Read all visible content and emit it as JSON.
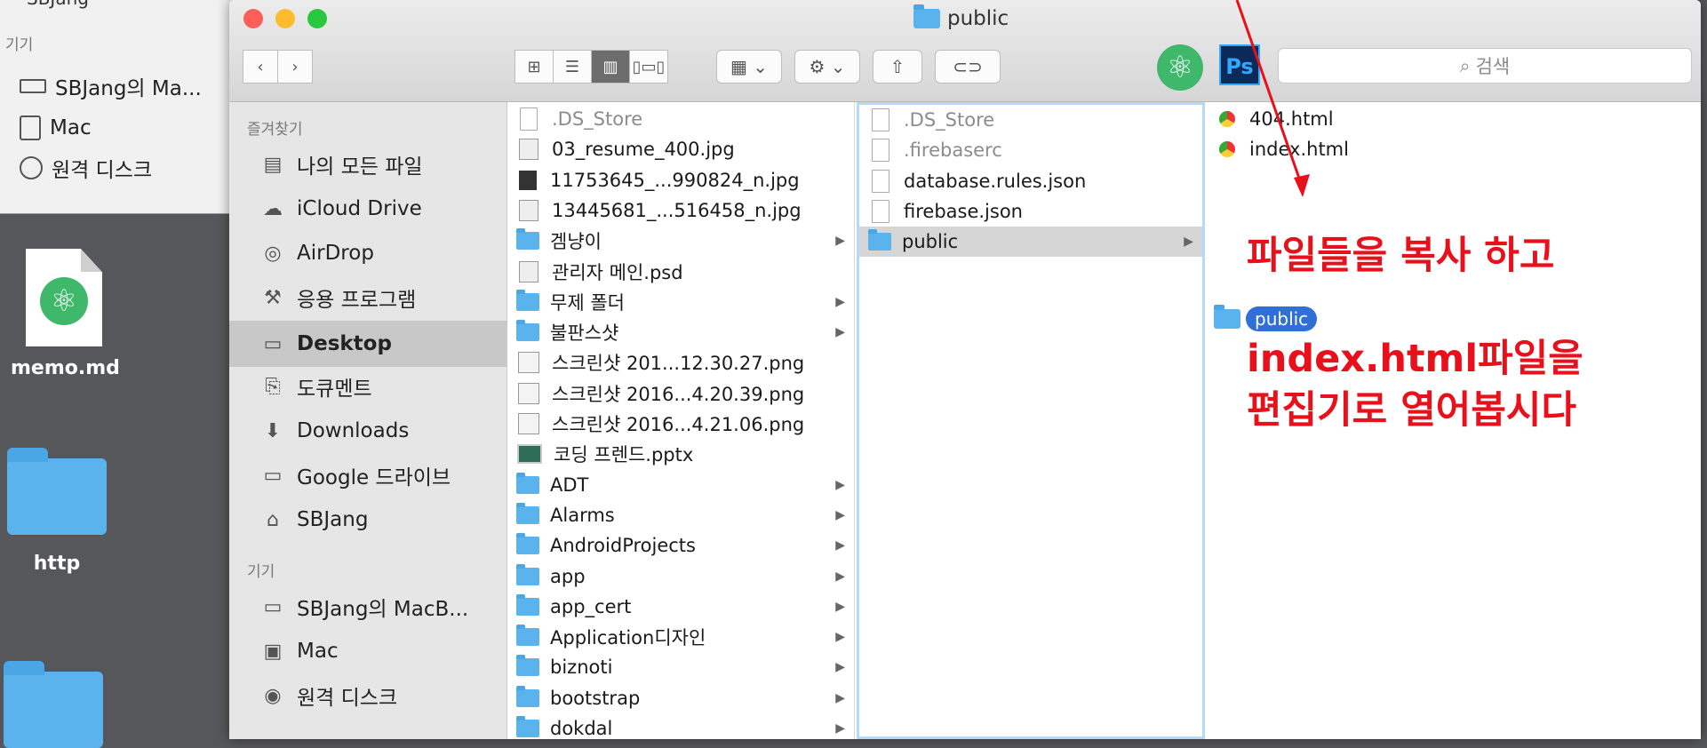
{
  "bg_window": {
    "clip_label": "SBJang",
    "section": "기기",
    "items": [
      {
        "label": "SBJang의 Ma...",
        "icon": "laptop-icon"
      },
      {
        "label": "Mac",
        "icon": "disk-icon"
      },
      {
        "label": "원격 디스크",
        "icon": "optical-disc-icon"
      }
    ]
  },
  "desktop": {
    "icons": [
      {
        "label": "memo.md",
        "icon": "atom-document-icon"
      },
      {
        "label": "http",
        "icon": "folder-alias-icon"
      },
      {
        "label": "",
        "icon": "folder-icon"
      }
    ]
  },
  "window": {
    "title": "public",
    "search_placeholder": "검색",
    "toolbar": {
      "view_icons": [
        "icon-view-icon",
        "list-view-icon",
        "column-view-icon",
        "cover-flow-icon"
      ],
      "active_view": "column-view-icon",
      "arrange_icon": "arrange-icon",
      "action_icon": "gear-icon",
      "share_icon": "share-icon",
      "tag_icon": "tag-icon",
      "apps": [
        "atom-app-icon",
        "photoshop-app-icon"
      ],
      "ps_label": "Ps"
    }
  },
  "sidebar": {
    "favorites_head": "즐겨찾기",
    "favorites": [
      {
        "label": "나의 모든 파일",
        "icon": "all-files-icon"
      },
      {
        "label": "iCloud Drive",
        "icon": "cloud-icon"
      },
      {
        "label": "AirDrop",
        "icon": "airdrop-icon"
      },
      {
        "label": "응용 프로그램",
        "icon": "applications-icon"
      },
      {
        "label": "Desktop",
        "icon": "desktop-icon",
        "selected": true
      },
      {
        "label": "도큐멘트",
        "icon": "documents-icon"
      },
      {
        "label": "Downloads",
        "icon": "downloads-icon"
      },
      {
        "label": "Google 드라이브",
        "icon": "folder-icon"
      },
      {
        "label": "SBJang",
        "icon": "home-icon"
      }
    ],
    "devices_head": "기기",
    "devices": [
      {
        "label": "SBJang의 MacB...",
        "icon": "laptop-icon"
      },
      {
        "label": "Mac",
        "icon": "disk-icon"
      },
      {
        "label": "원격 디스크",
        "icon": "optical-disc-icon"
      }
    ]
  },
  "column1": [
    {
      "name": ".DS_Store",
      "kind": "file",
      "hidden": true
    },
    {
      "name": "03_resume_400.jpg",
      "kind": "img"
    },
    {
      "name": "11753645_...990824_n.jpg",
      "kind": "dark"
    },
    {
      "name": "13445681_...516458_n.jpg",
      "kind": "img"
    },
    {
      "name": "겜냥이",
      "kind": "folder",
      "arrow": true
    },
    {
      "name": "관리자 메인.psd",
      "kind": "img"
    },
    {
      "name": "무제 폴더",
      "kind": "folder",
      "arrow": true
    },
    {
      "name": "불판스샷",
      "kind": "folder",
      "arrow": true
    },
    {
      "name": "스크린샷 201...12.30.27.png",
      "kind": "doc"
    },
    {
      "name": "스크린샷 2016...4.20.39.png",
      "kind": "doc"
    },
    {
      "name": "스크린샷 2016...4.21.06.png",
      "kind": "doc"
    },
    {
      "name": "코딩 프렌드.pptx",
      "kind": "ppt"
    },
    {
      "name": "ADT",
      "kind": "folder",
      "arrow": true
    },
    {
      "name": "Alarms",
      "kind": "folder",
      "arrow": true
    },
    {
      "name": "AndroidProjects",
      "kind": "folder",
      "arrow": true
    },
    {
      "name": "app",
      "kind": "folder",
      "arrow": true
    },
    {
      "name": "app_cert",
      "kind": "folder",
      "arrow": true
    },
    {
      "name": "Application디자인",
      "kind": "folder",
      "arrow": true
    },
    {
      "name": "biznoti",
      "kind": "folder",
      "arrow": true
    },
    {
      "name": "bootstrap",
      "kind": "folder",
      "arrow": true
    },
    {
      "name": "dokdal",
      "kind": "folder",
      "arrow": true
    }
  ],
  "column2": [
    {
      "name": ".DS_Store",
      "kind": "file",
      "hidden": true
    },
    {
      "name": ".firebaserc",
      "kind": "file",
      "hidden": true
    },
    {
      "name": "database.rules.json",
      "kind": "file"
    },
    {
      "name": "firebase.json",
      "kind": "file"
    },
    {
      "name": "public",
      "kind": "folder",
      "arrow": true,
      "selected": true
    }
  ],
  "column3": [
    {
      "name": "404.html",
      "kind": "html"
    },
    {
      "name": "index.html",
      "kind": "html"
    }
  ],
  "drag_label": "public",
  "annotation": {
    "line1": "파일들을 복사 하고",
    "line2": "index.html파일을",
    "line3": "편집기로 열어봅시다",
    "color": "#e8111b"
  }
}
